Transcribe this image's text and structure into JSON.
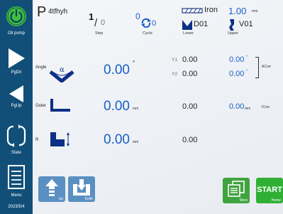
{
  "sidebar": {
    "oil_pump": "Oil pump",
    "pgdn": "PgDn",
    "pgup": "PgUp",
    "state": "State",
    "menu": "Menu",
    "date": "2023/5/4"
  },
  "header": {
    "program_letter": "P",
    "program_name": "4tfhyh",
    "step_current": "1",
    "step_slash": "/",
    "step_total": "0",
    "step_label": "Step",
    "cycle_current": "0",
    "cycle_total": "0",
    "cycle_label": "Cycle",
    "material": "Iron",
    "thickness": "1.00",
    "thickness_unit": "mm",
    "lower_die": "D01",
    "lower_label": "Lower",
    "upper_die": "V01",
    "upper_label": "Upper"
  },
  "rows": {
    "angle": {
      "label": "Angle",
      "symbol": "α",
      "value": "0.00",
      "unit": "°",
      "y1_label": "Y1",
      "y1_value": "0.00",
      "y2_label": "Y2",
      "y2_value": "0.00",
      "acorr1": "0.00",
      "acorr2": "0.00",
      "acorr_unit": "°",
      "acorr_label": "ACorr"
    },
    "outer": {
      "label": "Outer",
      "value": "0.00",
      "unit": "mm",
      "mid_value": "0.00",
      "corr_value": "0.00",
      "corr_unit": "mm",
      "corr_label": "ICorr"
    },
    "r": {
      "label": "R",
      "value": "0.00",
      "unit": "mm",
      "mid_value": "0.00"
    }
  },
  "bottom": {
    "up_label": "Up",
    "knife_label": "Knife",
    "more_label": "More",
    "start_label": "START",
    "home_label": "Home"
  },
  "colors": {
    "sidebar": "#114f78",
    "accent_blue": "#1a5ec8",
    "start_green": "#2fb035"
  }
}
